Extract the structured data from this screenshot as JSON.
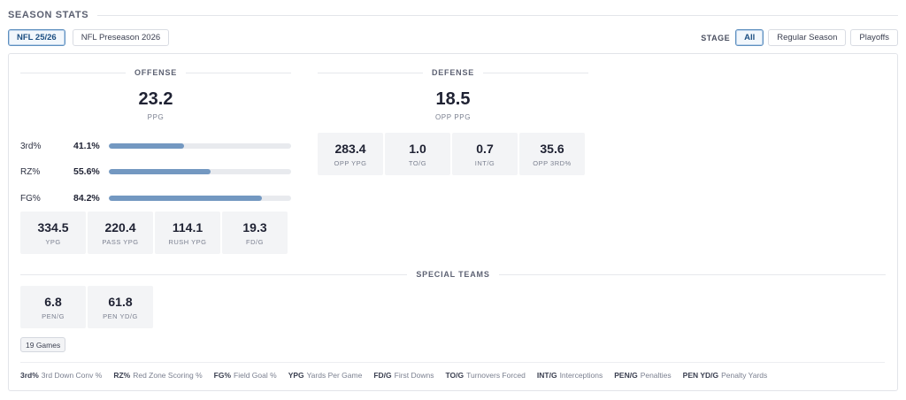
{
  "header": {
    "title": "SEASON STATS"
  },
  "seasons": [
    {
      "label": "NFL 25/26",
      "active": true
    },
    {
      "label": "NFL Preseason 2026",
      "active": false
    }
  ],
  "stage": {
    "label": "STAGE",
    "options": [
      {
        "label": "All",
        "active": true
      },
      {
        "label": "Regular Season",
        "active": false
      },
      {
        "label": "Playoffs",
        "active": false
      }
    ]
  },
  "offense": {
    "title": "OFFENSE",
    "ppg": "23.2",
    "ppg_label": "PPG",
    "bars": [
      {
        "label": "3rd%",
        "value": "41.1%",
        "pct": 41.1
      },
      {
        "label": "RZ%",
        "value": "55.6%",
        "pct": 55.6
      },
      {
        "label": "FG%",
        "value": "84.2%",
        "pct": 84.2
      }
    ],
    "tiles": [
      {
        "value": "334.5",
        "label": "YPG"
      },
      {
        "value": "220.4",
        "label": "PASS YPG"
      },
      {
        "value": "114.1",
        "label": "RUSH YPG"
      },
      {
        "value": "19.3",
        "label": "FD/G"
      }
    ]
  },
  "defense": {
    "title": "DEFENSE",
    "opp_ppg": "18.5",
    "opp_ppg_label": "OPP PPG",
    "tiles": [
      {
        "value": "283.4",
        "label": "OPP YPG"
      },
      {
        "value": "1.0",
        "label": "TO/G"
      },
      {
        "value": "0.7",
        "label": "INT/G"
      },
      {
        "value": "35.6",
        "label": "OPP 3RD%"
      }
    ]
  },
  "special_teams": {
    "title": "SPECIAL TEAMS",
    "tiles": [
      {
        "value": "6.8",
        "label": "PEN/G"
      },
      {
        "value": "61.8",
        "label": "PEN YD/G"
      }
    ]
  },
  "games_badge": "19 Games",
  "legend": [
    {
      "key": "3rd%",
      "desc": "3rd Down Conv %"
    },
    {
      "key": "RZ%",
      "desc": "Red Zone Scoring %"
    },
    {
      "key": "FG%",
      "desc": "Field Goal %"
    },
    {
      "key": "YPG",
      "desc": "Yards Per Game"
    },
    {
      "key": "FD/G",
      "desc": "First Downs"
    },
    {
      "key": "TO/G",
      "desc": "Turnovers Forced"
    },
    {
      "key": "INT/G",
      "desc": "Interceptions"
    },
    {
      "key": "PEN/G",
      "desc": "Penalties"
    },
    {
      "key": "PEN YD/G",
      "desc": "Penalty Yards"
    }
  ],
  "colors": {
    "accent": "#5d8fbf",
    "bar_fill": "#7398c1",
    "tile_bg": "#f3f4f6"
  }
}
